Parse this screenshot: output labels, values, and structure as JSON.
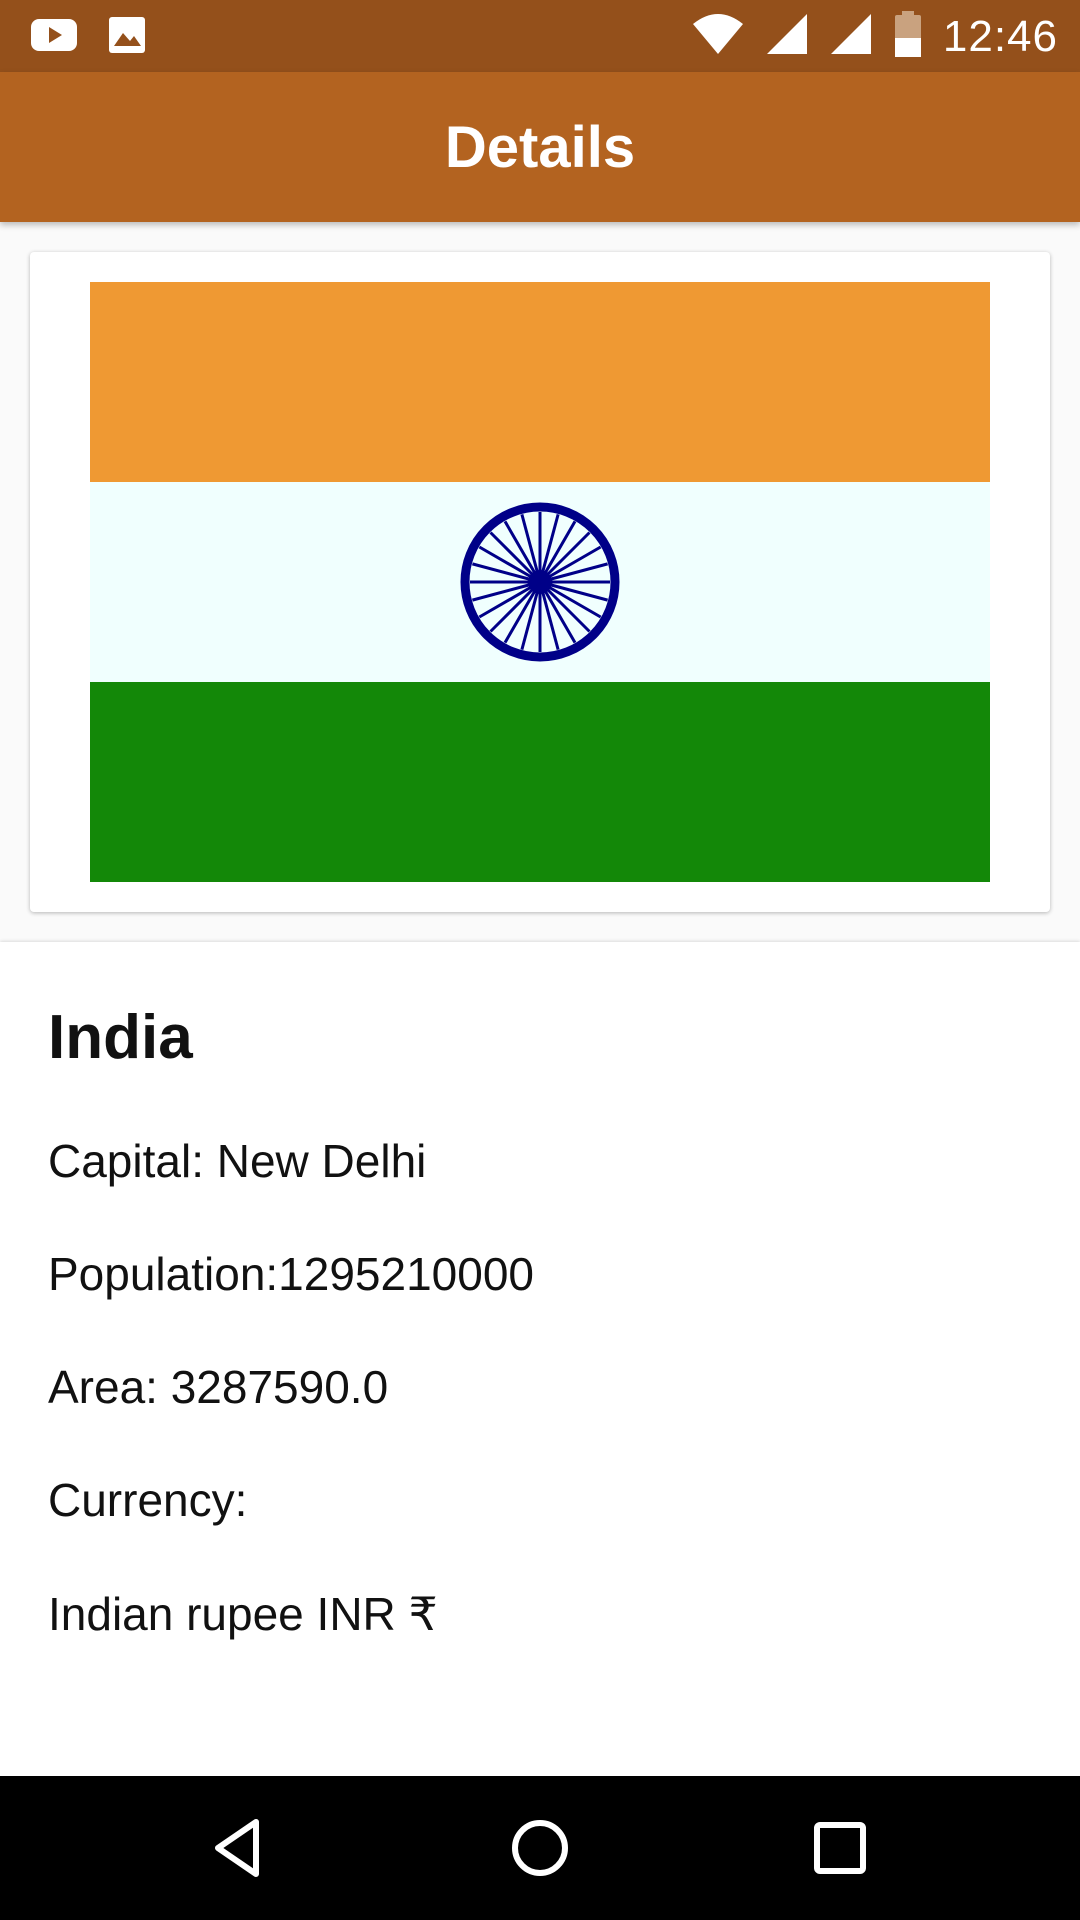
{
  "status_bar": {
    "time": "12:46",
    "icons": [
      "youtube-icon",
      "image-icon",
      "wifi-icon",
      "signal-icon",
      "signal-icon",
      "battery-icon"
    ]
  },
  "app_bar": {
    "title": "Details"
  },
  "flag": {
    "country": "India",
    "colors": {
      "saffron": "#ef9933",
      "white": "#f0fffe",
      "green": "#138808",
      "chakra": "#000088"
    }
  },
  "details": {
    "name": "India",
    "capital_line": "Capital: New Delhi",
    "population_line": "Population:1295210000",
    "area_line": "Area: 3287590.0",
    "currency_label": "Currency:",
    "currency_value": "Indian rupee  INR  ₹"
  },
  "nav_bar": {
    "buttons": [
      "back-icon",
      "home-icon",
      "recents-icon"
    ]
  },
  "colors": {
    "status_bar": "#94501b",
    "app_bar": "#b36320"
  }
}
